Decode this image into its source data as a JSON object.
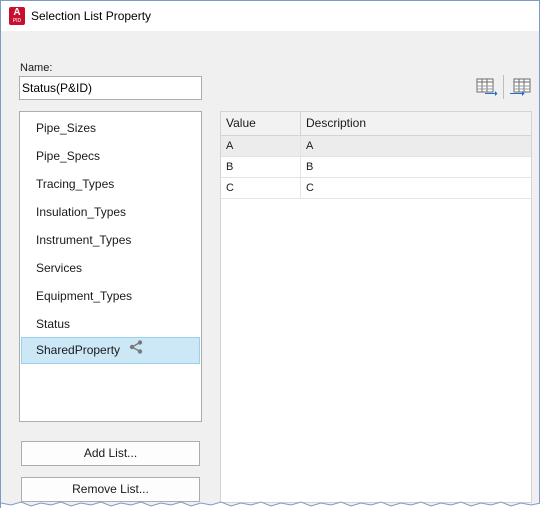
{
  "window": {
    "title": "Selection List Property",
    "app_icon_letter": "A",
    "app_icon_sub": "PID",
    "app_icon_color": "#c8102e"
  },
  "name_field": {
    "label": "Name:",
    "value": "Status(P&ID)"
  },
  "lists": {
    "items": [
      {
        "label": "Pipe_Sizes"
      },
      {
        "label": "Pipe_Specs"
      },
      {
        "label": "Tracing_Types"
      },
      {
        "label": "Insulation_Types"
      },
      {
        "label": "Instrument_Types"
      },
      {
        "label": "Services"
      },
      {
        "label": "Equipment_Types"
      },
      {
        "label": "Status"
      },
      {
        "label": "SharedProperty",
        "selected": true,
        "icon": "share-icon"
      }
    ],
    "selected_color": "#cce8f7"
  },
  "buttons": {
    "add": "Add List...",
    "remove": "Remove List..."
  },
  "toolbar": {
    "import_icon": "import-table-icon",
    "export_icon": "export-table-icon"
  },
  "grid": {
    "columns": [
      "Value",
      "Description"
    ],
    "rows": [
      {
        "value": "A",
        "description": "A",
        "selected": true
      },
      {
        "value": "B",
        "description": "B"
      },
      {
        "value": "C",
        "description": "C"
      }
    ]
  }
}
